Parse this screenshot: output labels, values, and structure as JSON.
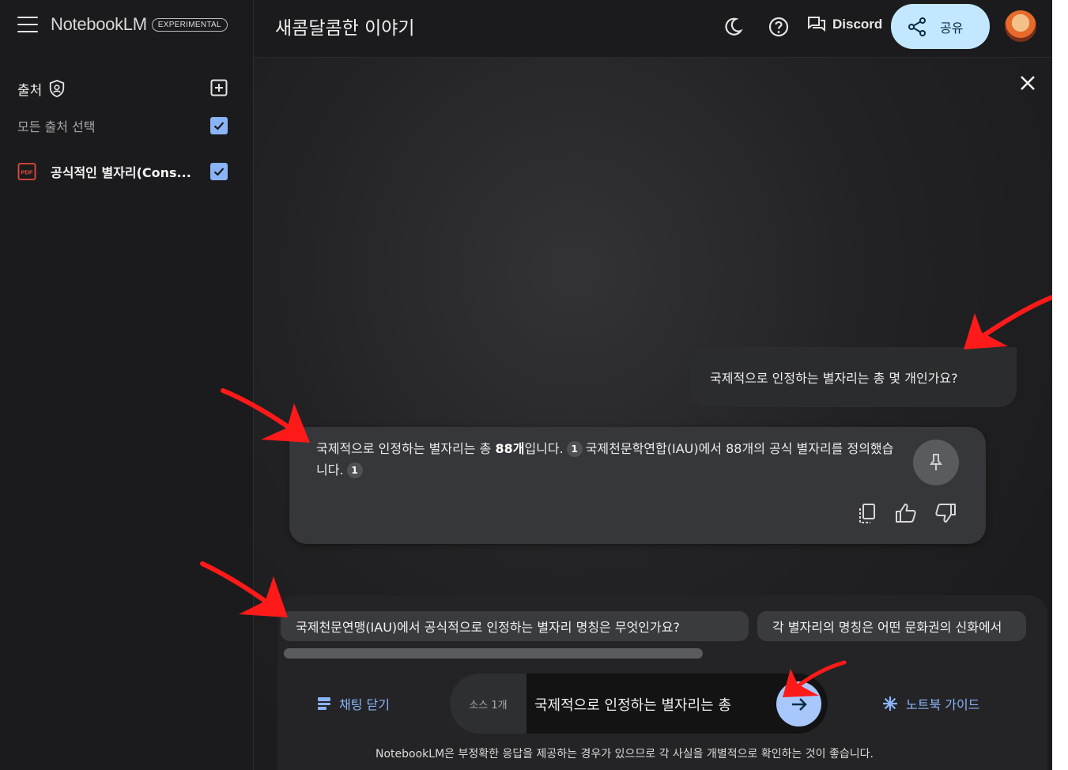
{
  "header": {
    "brand": "NotebookLM",
    "badge": "EXPERIMENTAL",
    "notebook_title": "새콤달콤한 이야기",
    "discord_label": "Discord",
    "share_label": "공유"
  },
  "sidebar": {
    "sources_title": "출처",
    "select_all_label": "모든 출처 선택",
    "sources": [
      {
        "name": "공식적인 별자리(Cons...",
        "type": "pdf",
        "checked": true
      }
    ]
  },
  "chat": {
    "user_message": "국제적으로 인정하는 별자리는 총 몇 개인가요?",
    "ai_part1": "국제적으로 인정하는 별자리는 총 ",
    "ai_bold": "88개",
    "ai_part2": "입니다.",
    "ai_part3": "국제천문학연합(IAU)에서 88개의 공식 별자리를 정의했습니다.",
    "citation": "1"
  },
  "suggestions": [
    "국제천문연맹(IAU)에서 공식적으로 인정하는 별자리 명칭은 무엇인가요?",
    "각 별자리의 명칭은 어떤 문화권의 신화에서"
  ],
  "footer": {
    "close_chat_label": "채팅 닫기",
    "source_count": "소스 1개",
    "input_value": "국제적으로 인정하는 별자리는 총",
    "guide_label": "노트북 가이드",
    "disclaimer": "NotebookLM은 부정확한 응답을 제공하는 경우가 있으므로 각 사실을 개별적으로 확인하는 것이 좋습니다."
  },
  "colors": {
    "accent": "#8ab4f8",
    "share_bg": "#c2e7ff",
    "annotation_arrow": "#ff1a1a"
  }
}
